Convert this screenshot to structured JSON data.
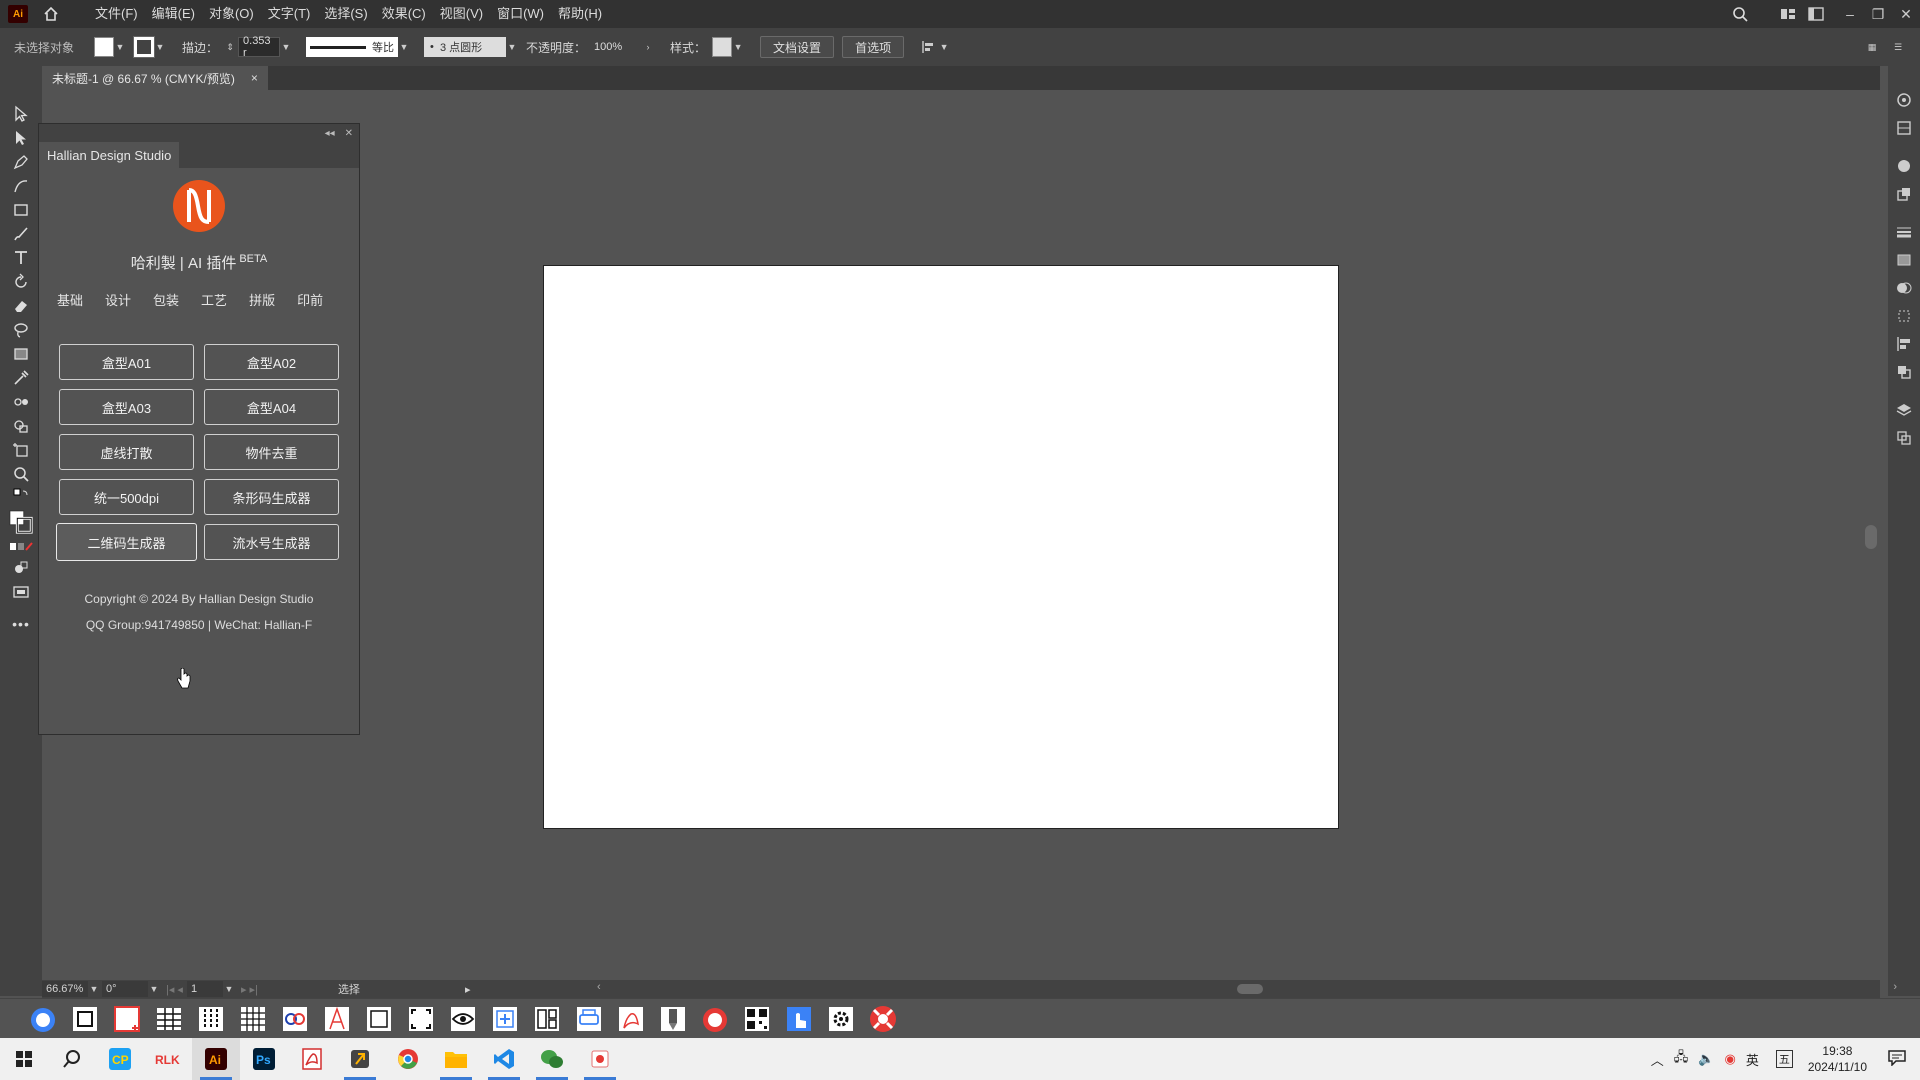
{
  "app": {
    "logo_text": "Ai"
  },
  "menu": [
    "文件(F)",
    "编辑(E)",
    "对象(O)",
    "文字(T)",
    "选择(S)",
    "效果(C)",
    "视图(V)",
    "窗口(W)",
    "帮助(H)"
  ],
  "control_bar": {
    "selection": "未选择对象",
    "stroke_label": "描边：",
    "stroke_value": "0.353 r",
    "line_label": "等比",
    "brush_label": "3 点圆形",
    "opacity_label": "不透明度：",
    "opacity_value": "100%",
    "style_label": "样式：",
    "doc_setup": "文档设置",
    "preferences": "首选项"
  },
  "document_tab": {
    "title": "未标题-1 @ 66.67 % (CMYK/预览)",
    "close": "×"
  },
  "panel": {
    "tab_title": "Hallian Design Studio",
    "heading": "哈利製 | AI 插件",
    "heading_sup": "BETA",
    "nav": [
      "基础",
      "设计",
      "包装",
      "工艺",
      "拼版",
      "印前"
    ],
    "buttons": [
      "盒型A01",
      "盒型A02",
      "盒型A03",
      "盒型A04",
      "虚线打散",
      "物件去重",
      "统一500dpi",
      "条形码生成器",
      "二维码生成器",
      "流水号生成器"
    ],
    "copyright": "Copyright © 2024 By Hallian Design Studio",
    "contact": "QQ Group:941749850 | WeChat: Hallian-F"
  },
  "status_bar": {
    "zoom": "66.67%",
    "rotation": "0°",
    "page": "1",
    "tool": "选择"
  },
  "taskbar": {
    "ime_lang": "英",
    "ime_mode": "五",
    "time": "19:38",
    "date": "2024/11/10"
  },
  "colors": {
    "accent": "#e9541c",
    "ui_bg": "#535353",
    "panel_dark": "#424242"
  }
}
